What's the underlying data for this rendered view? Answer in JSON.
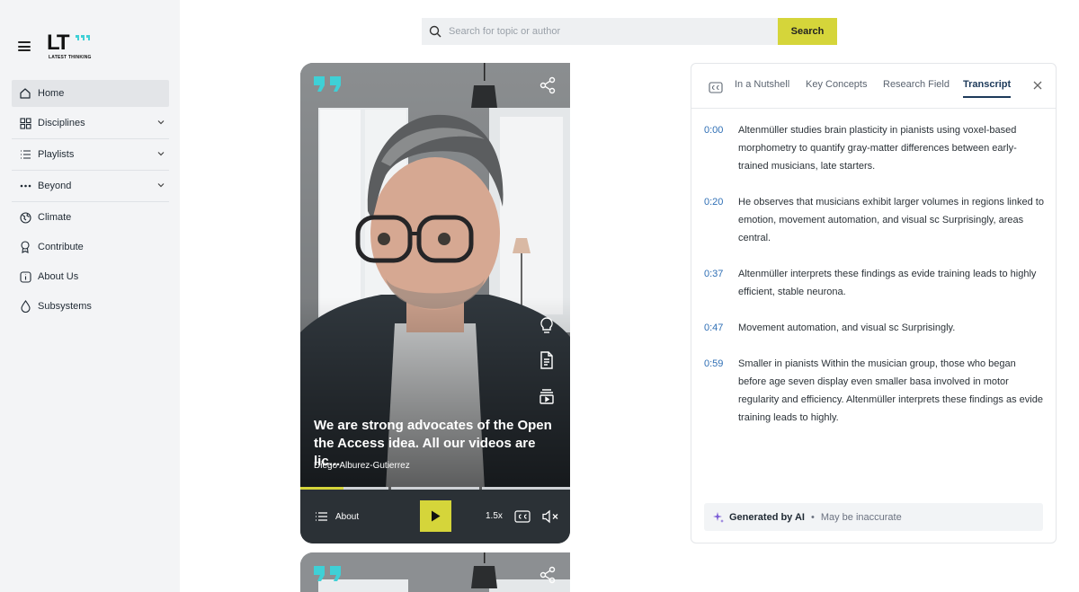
{
  "logo": {
    "mark": "LT",
    "subtitle": "LATEST THINKING"
  },
  "sidebar": {
    "items": [
      {
        "label": "Home",
        "icon": "home-icon"
      },
      {
        "label": "Disciplines",
        "icon": "grid-icon"
      },
      {
        "label": "Playlists",
        "icon": "list-icon"
      },
      {
        "label": "Beyond",
        "icon": "more-icon"
      },
      {
        "label": "Climate",
        "icon": "globe-icon"
      },
      {
        "label": "Contribute",
        "icon": "award-icon"
      },
      {
        "label": "About Us",
        "icon": "info-icon"
      },
      {
        "label": "Subsystems",
        "icon": "drop-icon"
      }
    ]
  },
  "search": {
    "placeholder": "Search for topic or author",
    "button_label": "Search"
  },
  "video": {
    "caption": "We are strong advocates of the Open the Access idea. All our videos are lic...",
    "author": "Diego Alburez-Gutierrez",
    "about_label": "About",
    "speed": "1.5x",
    "progress": 0.16
  },
  "panel": {
    "tabs": [
      {
        "label": "In a Nutshell"
      },
      {
        "label": "Key Concepts"
      },
      {
        "label": "Research Field"
      },
      {
        "label": "Transcript"
      }
    ],
    "active_tab": "Transcript",
    "transcript": [
      {
        "time": "0:00",
        "text": "Altenmüller studies brain plasticity in pianists using voxel-based morphometry to quantify gray-matter differences between early-trained musicians, late starters."
      },
      {
        "time": "0:20",
        "text": "He observes that musicians exhibit larger volumes in regions linked to emotion, movement automation, and visual sc Surprisingly, areas central."
      },
      {
        "time": "0:37",
        "text": "Altenmüller interprets these findings as evide training leads to highly efficient, stable neurona."
      },
      {
        "time": "0:47",
        "text": "Movement automation, and visual sc Surprisingly."
      },
      {
        "time": "0:59",
        "text": "Smaller in pianists Within the musician group, those who began before age seven display even smaller basa involved in motor regularity and efficiency. Altenmüller interprets these findings as evide training leads to highly."
      }
    ],
    "ai_label": "Generated by AI",
    "ai_note": "May be inaccurate"
  },
  "colors": {
    "accent": "#d5d53a",
    "teal": "#3fd0d6",
    "link": "#2f6fb5",
    "active_tab": "#1d3a5a"
  }
}
